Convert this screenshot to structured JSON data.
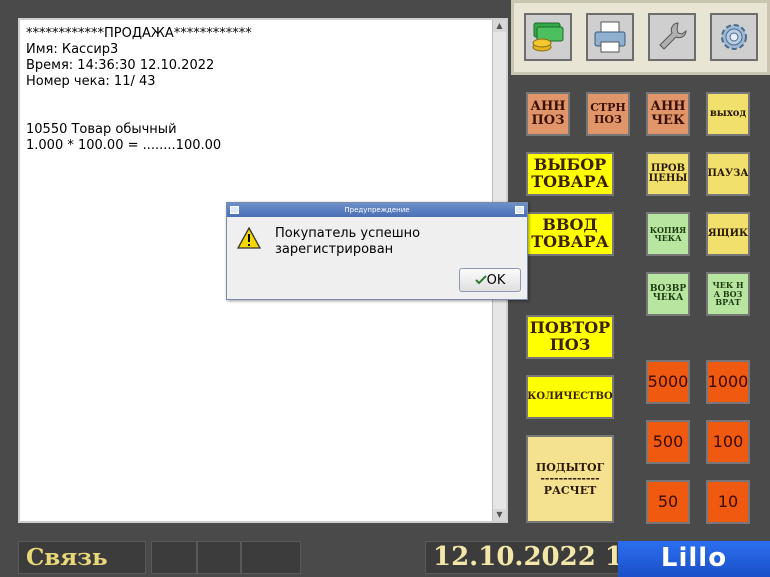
{
  "receipt": {
    "lines": "************ПРОДАЖА************\nИмя: Кассир3\nВремя: 14:36:30 12.10.2022\nНомер чека: 11/ 43\n\n\n10550 Товар обычный\n1.000 * 100.00 = ........100.00"
  },
  "toolbar": {
    "icons": [
      "money-icon",
      "printer-icon",
      "wrench-icon",
      "gear-icon"
    ]
  },
  "buttons": {
    "ann_poz": "АНН\nПОЗ",
    "strn_poz": "СТРН\nПОЗ",
    "ann_chek": "АНН\nЧЕК",
    "vyhod": "выход",
    "vybor_tovara": "ВЫБОР\nТОВАРА",
    "prov_tseny": "ПРОВ\nЦЕНЫ",
    "pauza": "ПАУЗА",
    "vvod_tovara": "ВВОД\nТОВАРА",
    "kopiya_cheka": "КОПИЯ\nЧЕКА",
    "yashchik": "ЯЩИК",
    "vozvr_cheka": "ВОЗВР\nЧЕКА",
    "chek_na_vozvrat": "ЧЕК Н\nА ВОЗ\nВРАТ",
    "povtor_poz": "ПОВТОР\nПОЗ",
    "kolichestvo": "КОЛИЧЕСТВО",
    "podytog_raschet": "ПОДЫТОГ\n-------------\nРАСЧЕТ",
    "d5000": "5000",
    "d1000": "1000",
    "d500": "500",
    "d100": "100",
    "d50": "50",
    "d10": "10"
  },
  "dialog": {
    "title": "Предупреждение",
    "message": "Покупатель успешно\nзарегистрирован",
    "ok_label": "OK"
  },
  "status": {
    "connection": "Связь",
    "datetime": "12.10.2022 1",
    "logo": "Lillo"
  },
  "colors": {
    "background": "#4a4a4a",
    "accent_yellow": "#ffff00",
    "denomination_red": "#f05a10",
    "logo_blue": "#2a6ff0"
  }
}
